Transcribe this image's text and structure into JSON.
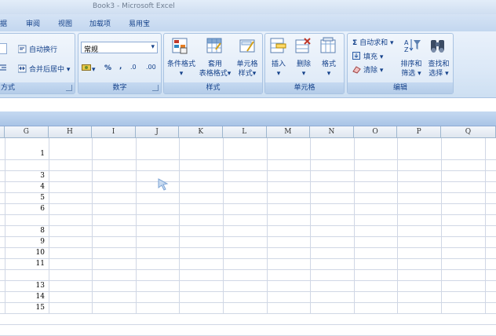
{
  "window": {
    "title": "Book3 - Microsoft Excel"
  },
  "tabs": [
    "据",
    "审阅",
    "视图",
    "加载项",
    "易用宝"
  ],
  "ribbon": {
    "alignment": {
      "wrap_text": "自动换行",
      "merge_center": "合并后居中",
      "group_label": "方式"
    },
    "number": {
      "format_value": "常规",
      "percent": "%",
      "comma": ",",
      "inc_decimal": ".0",
      "dec_decimal": ".00",
      "group_label": "数字"
    },
    "styles": {
      "conditional_format": "条件格式",
      "table_format_1": "套用",
      "table_format_2": "表格格式",
      "cell_style_1": "单元格",
      "cell_style_2": "样式",
      "group_label": "样式"
    },
    "cells": {
      "insert": "插入",
      "delete": "删除",
      "format": "格式",
      "group_label": "单元格"
    },
    "editing": {
      "autosum": "自动求和",
      "fill": "填充",
      "clear": "清除",
      "sort_filter_1": "排序和",
      "sort_filter_2": "筛选",
      "find_select_1": "查找和",
      "find_select_2": "选择",
      "group_label": "编辑"
    }
  },
  "sheet": {
    "columns": [
      "G",
      "H",
      "I",
      "J",
      "K",
      "L",
      "M",
      "N",
      "O",
      "P",
      "Q"
    ],
    "values": [
      {
        "row": 1,
        "value": "1"
      },
      {
        "row": 3,
        "value": "3"
      },
      {
        "row": 4,
        "value": "4"
      },
      {
        "row": 5,
        "value": "5"
      },
      {
        "row": 6,
        "value": "6"
      },
      {
        "row": 8,
        "value": "8"
      },
      {
        "row": 9,
        "value": "9"
      },
      {
        "row": 10,
        "value": "10"
      },
      {
        "row": 11,
        "value": "11"
      },
      {
        "row": 13,
        "value": "13"
      },
      {
        "row": 14,
        "value": "14"
      },
      {
        "row": 15,
        "value": "15"
      }
    ]
  },
  "colors": {
    "ribbon_text": "#15428b",
    "gridline": "#d0d7e5",
    "header_border": "#9eb6ce"
  }
}
